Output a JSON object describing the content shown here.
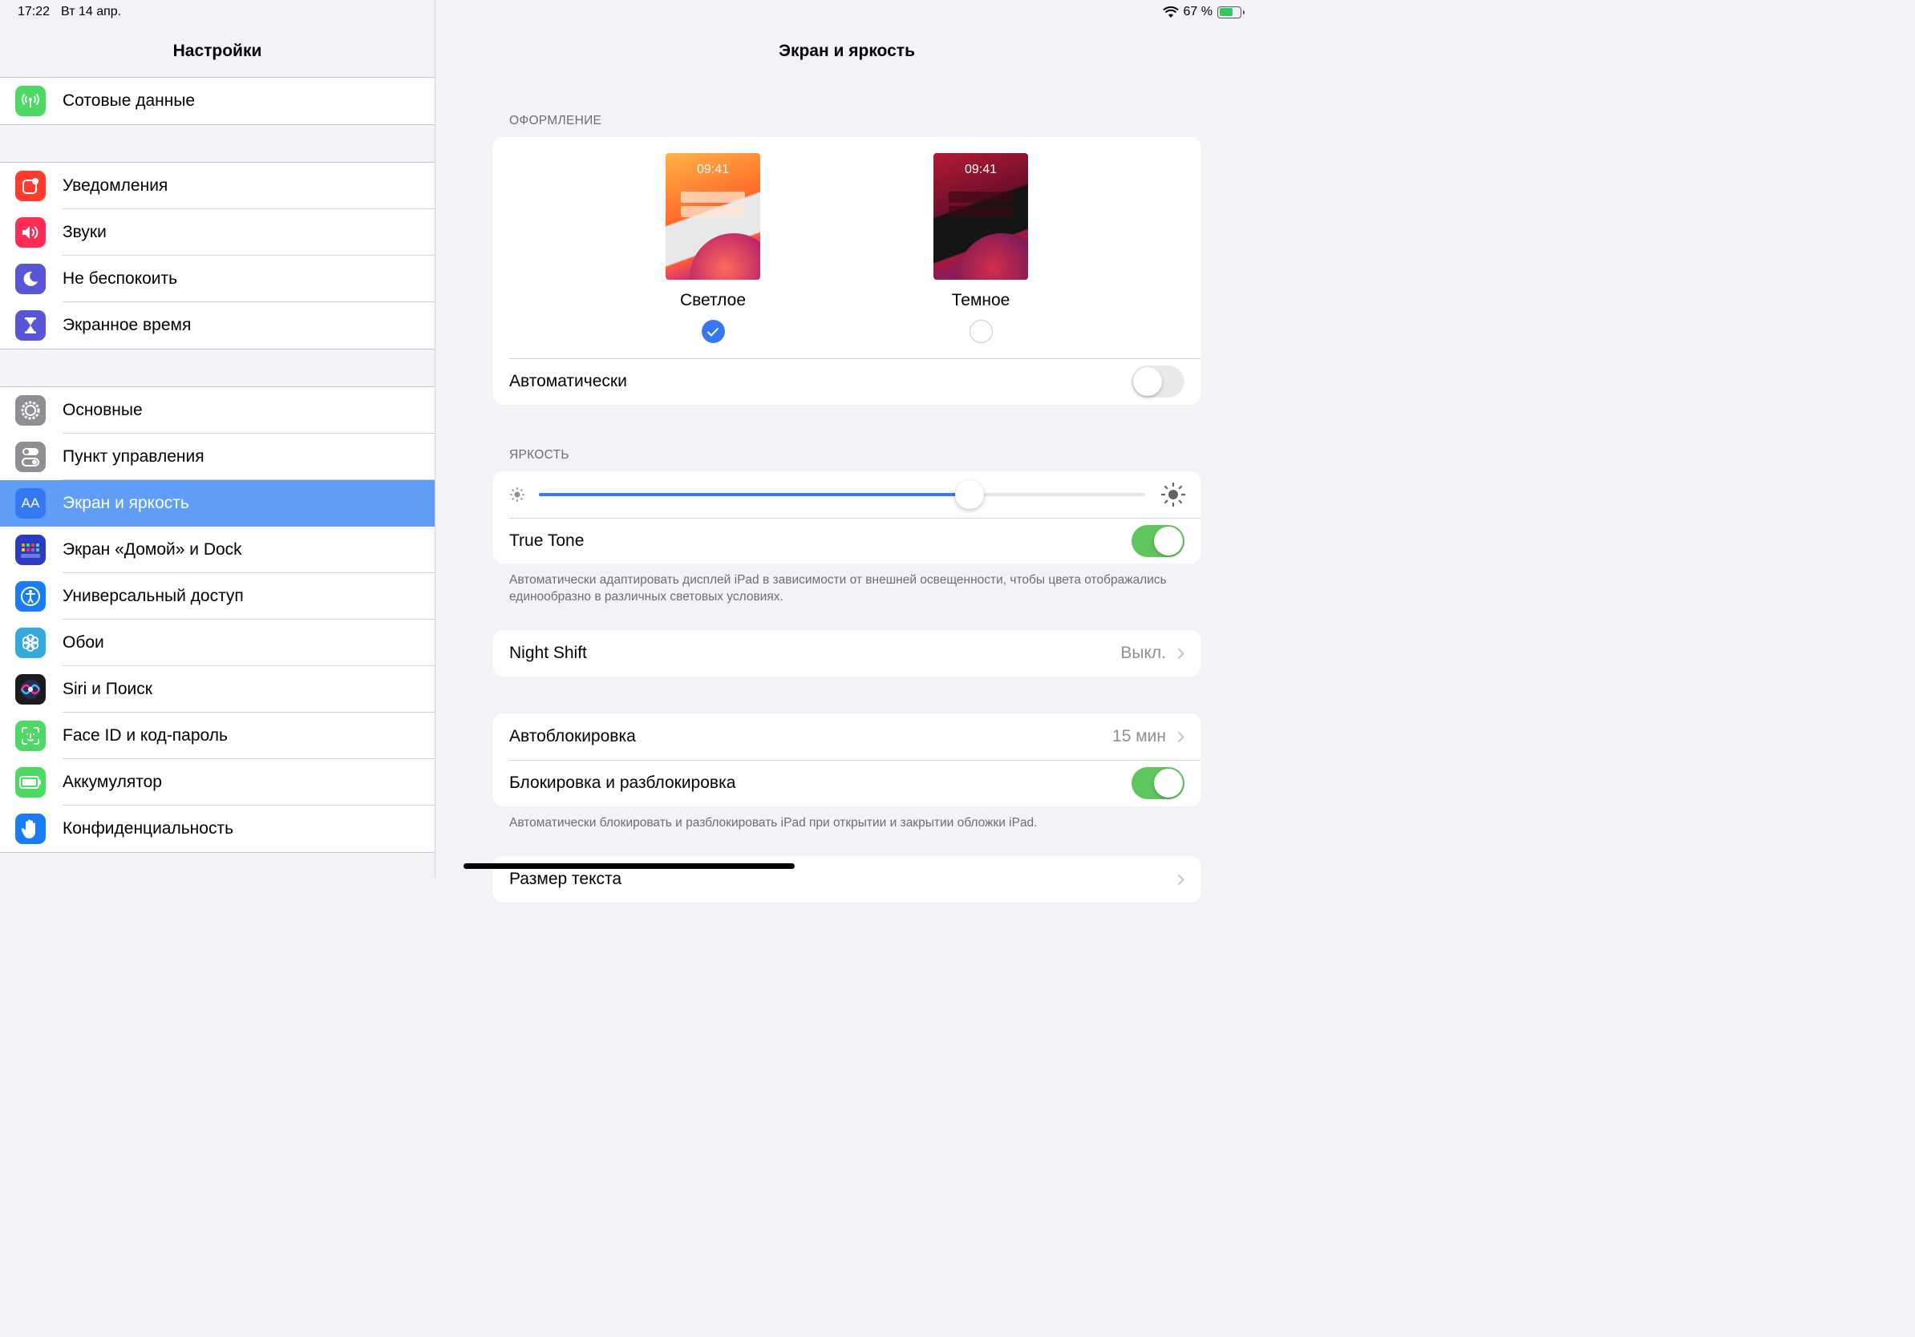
{
  "status_bar": {
    "time": "17:22",
    "date": "Вт 14 апр.",
    "battery_percent": "67 %",
    "battery_level": 0.67
  },
  "sidebar": {
    "title": "Настройки",
    "groups": [
      {
        "items": [
          {
            "label": "Сотовые данные",
            "icon": "antenna-icon",
            "color": "#4cd964"
          }
        ]
      },
      {
        "items": [
          {
            "label": "Уведомления",
            "icon": "notifications-icon",
            "color": "#ff3b30"
          },
          {
            "label": "Звуки",
            "icon": "speaker-icon",
            "color": "#ff2d55"
          },
          {
            "label": "Не беспокоить",
            "icon": "moon-icon",
            "color": "#5856d6"
          },
          {
            "label": "Экранное время",
            "icon": "hourglass-icon",
            "color": "#5856d6"
          }
        ]
      },
      {
        "items": [
          {
            "label": "Основные",
            "icon": "gear-icon",
            "color": "#8e8e93"
          },
          {
            "label": "Пункт управления",
            "icon": "toggles-icon",
            "color": "#8e8e93"
          },
          {
            "label": "Экран и яркость",
            "icon": "text-size-icon",
            "color": "#3478f6",
            "icon_text": "AA",
            "active": true
          },
          {
            "label": "Экран «Домой» и Dock",
            "icon": "app-grid-icon",
            "color": "#2c3cc2"
          },
          {
            "label": "Универсальный доступ",
            "icon": "accessibility-icon",
            "color": "#1a7cf5"
          },
          {
            "label": "Обои",
            "icon": "flower-icon",
            "color": "#34aadc"
          },
          {
            "label": "Siri и Поиск",
            "icon": "siri-icon",
            "color": "#1c1c1e"
          },
          {
            "label": "Face ID и код-пароль",
            "icon": "face-id-icon",
            "color": "#4cd964"
          },
          {
            "label": "Аккумулятор",
            "icon": "battery-icon",
            "color": "#4cd964"
          },
          {
            "label": "Конфиденциальность",
            "icon": "hand-icon",
            "color": "#1a7cf5"
          }
        ]
      }
    ]
  },
  "detail": {
    "title": "Экран и яркость",
    "appearance": {
      "section_label": "ОФОРМЛЕНИЕ",
      "light": {
        "label": "Светлое",
        "preview_time": "09:41",
        "selected": true
      },
      "dark": {
        "label": "Темное",
        "preview_time": "09:41",
        "selected": false
      },
      "automatic_label": "Автоматически",
      "automatic_on": false
    },
    "brightness": {
      "section_label": "ЯРКОСТЬ",
      "level": 0.71,
      "true_tone_label": "True Tone",
      "true_tone_on": true,
      "footnote": "Автоматически адаптировать дисплей iPad в зависимости от внешней освещенности, чтобы цвета отображались единообразно в различных световых условиях."
    },
    "night_shift": {
      "label": "Night Shift",
      "value": "Выкл."
    },
    "lock": {
      "auto_lock_label": "Автоблокировка",
      "auto_lock_value": "15 мин",
      "lock_unlock_label": "Блокировка и разблокировка",
      "lock_unlock_on": true,
      "footnote": "Автоматически блокировать и разблокировать iPad при открытии и закрытии обложки iPad."
    },
    "text_size": {
      "label": "Размер текста"
    }
  },
  "colors": {
    "accent": "#3478f6",
    "toggle_on": "#5fc65d",
    "selected_row": "#5e9ef6"
  }
}
